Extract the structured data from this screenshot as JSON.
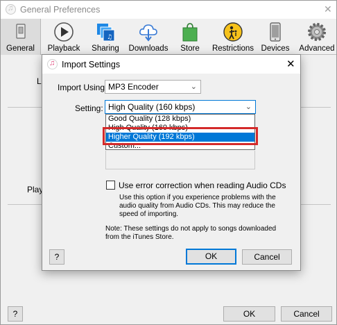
{
  "outer_window": {
    "title": "General Preferences",
    "close_glyph": "✕",
    "toolbar": [
      {
        "label": "General",
        "icon": "general-switch-icon"
      },
      {
        "label": "Playback",
        "icon": "play-icon"
      },
      {
        "label": "Sharing",
        "icon": "sharing-icon"
      },
      {
        "label": "Downloads",
        "icon": "cloud-download-icon"
      },
      {
        "label": "Store",
        "icon": "shopping-bag-icon"
      },
      {
        "label": "Restrictions",
        "icon": "restrictions-icon"
      },
      {
        "label": "Devices",
        "icon": "device-icon"
      },
      {
        "label": "Advanced",
        "icon": "gear-icon"
      }
    ],
    "fragment_l": "L",
    "fragment_play": "Playb",
    "help_label": "?",
    "ok_label": "OK",
    "cancel_label": "Cancel"
  },
  "dialog": {
    "title": "Import Settings",
    "close_glyph": "✕",
    "import_using_label": "Import Using:",
    "import_using_value": "MP3 Encoder",
    "setting_label": "Setting:",
    "setting_value": "High Quality (160 kbps)",
    "options": [
      "Good Quality (128 kbps)",
      "High Quality (160 kbps)",
      "Higher Quality (192 kbps)",
      "Custom..."
    ],
    "highlighted_index": 2,
    "error_correction_label": "Use error correction when reading Audio CDs",
    "error_correction_checked": false,
    "error_correction_desc": "Use this option if you experience problems with the audio quality from Audio CDs. This may reduce the speed of importing.",
    "note": "Note: These settings do not apply to songs downloaded from the iTunes Store.",
    "help_label": "?",
    "ok_label": "OK",
    "cancel_label": "Cancel"
  },
  "colors": {
    "selection_blue": "#0078d7",
    "highlight_red": "#d42a2a"
  }
}
